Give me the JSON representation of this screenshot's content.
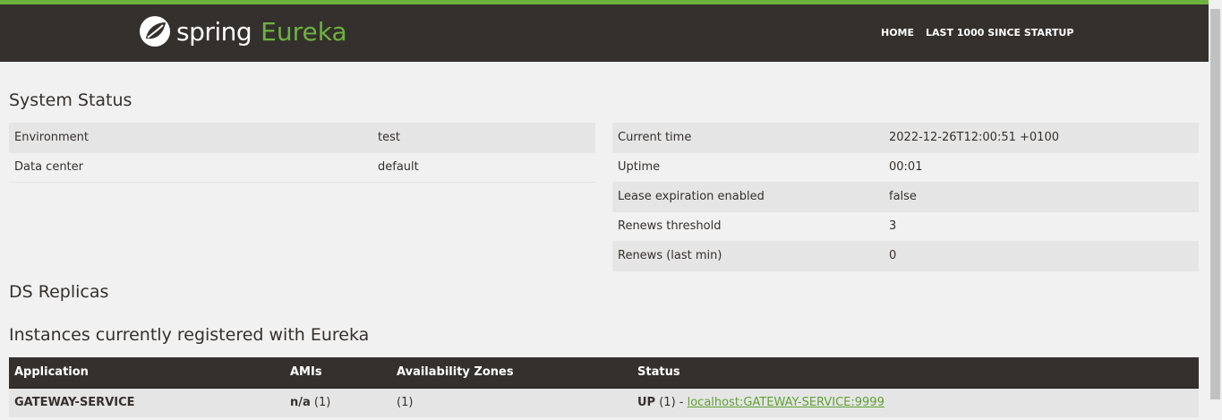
{
  "header": {
    "logo_spring": "spring",
    "logo_eureka": "Eureka",
    "nav": [
      "HOME",
      "LAST 1000 SINCE STARTUP"
    ]
  },
  "system_status": {
    "title": "System Status",
    "left": [
      {
        "k": "Environment",
        "v": "test"
      },
      {
        "k": "Data center",
        "v": "default"
      }
    ],
    "right": [
      {
        "k": "Current time",
        "v": "2022-12-26T12:00:51 +0100"
      },
      {
        "k": "Uptime",
        "v": "00:01"
      },
      {
        "k": "Lease expiration enabled",
        "v": "false"
      },
      {
        "k": "Renews threshold",
        "v": "3"
      },
      {
        "k": "Renews (last min)",
        "v": "0"
      }
    ]
  },
  "ds_replicas": {
    "title": "DS Replicas"
  },
  "instances": {
    "title": "Instances currently registered with Eureka",
    "columns": [
      "Application",
      "AMIs",
      "Availability Zones",
      "Status"
    ],
    "rows": [
      {
        "app": "GATEWAY-SERVICE",
        "ami": "n/a",
        "ami_count": "(1)",
        "zones": "(1)",
        "status": "UP",
        "status_count": "(1) - ",
        "link": "localhost:GATEWAY-SERVICE:9999"
      }
    ]
  },
  "colors": {
    "brand": "#6db33f",
    "dark": "#34302d"
  }
}
